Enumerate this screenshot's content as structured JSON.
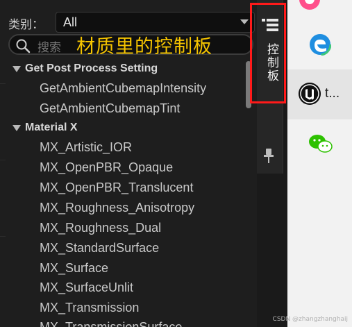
{
  "panel": {
    "category_label": "类别：",
    "category_value": "All",
    "search_placeholder": "搜索",
    "overlay_title": "材质里的控制板"
  },
  "tree": {
    "categories": [
      {
        "label": "Get Post Process Setting",
        "items": [
          "GetAmbientCubemapIntensity",
          "GetAmbientCubemapTint"
        ]
      },
      {
        "label": "Material X",
        "items": [
          "MX_Artistic_IOR",
          "MX_OpenPBR_Opaque",
          "MX_OpenPBR_Translucent",
          "MX_Roughness_Anisotropy",
          "MX_Roughness_Dual",
          "MX_StandardSurface",
          "MX_Surface",
          "MX_SurfaceUnlit",
          "MX_Transmission",
          "MX_TransmissionSurface"
        ]
      }
    ]
  },
  "tab_strip": {
    "palette_tab_label": "控制板",
    "menu_icon": "list-icon",
    "pin_icon": "pin-icon"
  },
  "desktop": {
    "unreal_app_label": "t...",
    "icons": [
      "app-icon",
      "edge-icon",
      "unreal-icon",
      "wechat-icon"
    ]
  },
  "watermark": "CSDN @zhangzhanghaij",
  "colors": {
    "accent_yellow": "#f5c400",
    "highlight_red": "#ff1a1a",
    "panel_bg": "#1e1e1e"
  }
}
